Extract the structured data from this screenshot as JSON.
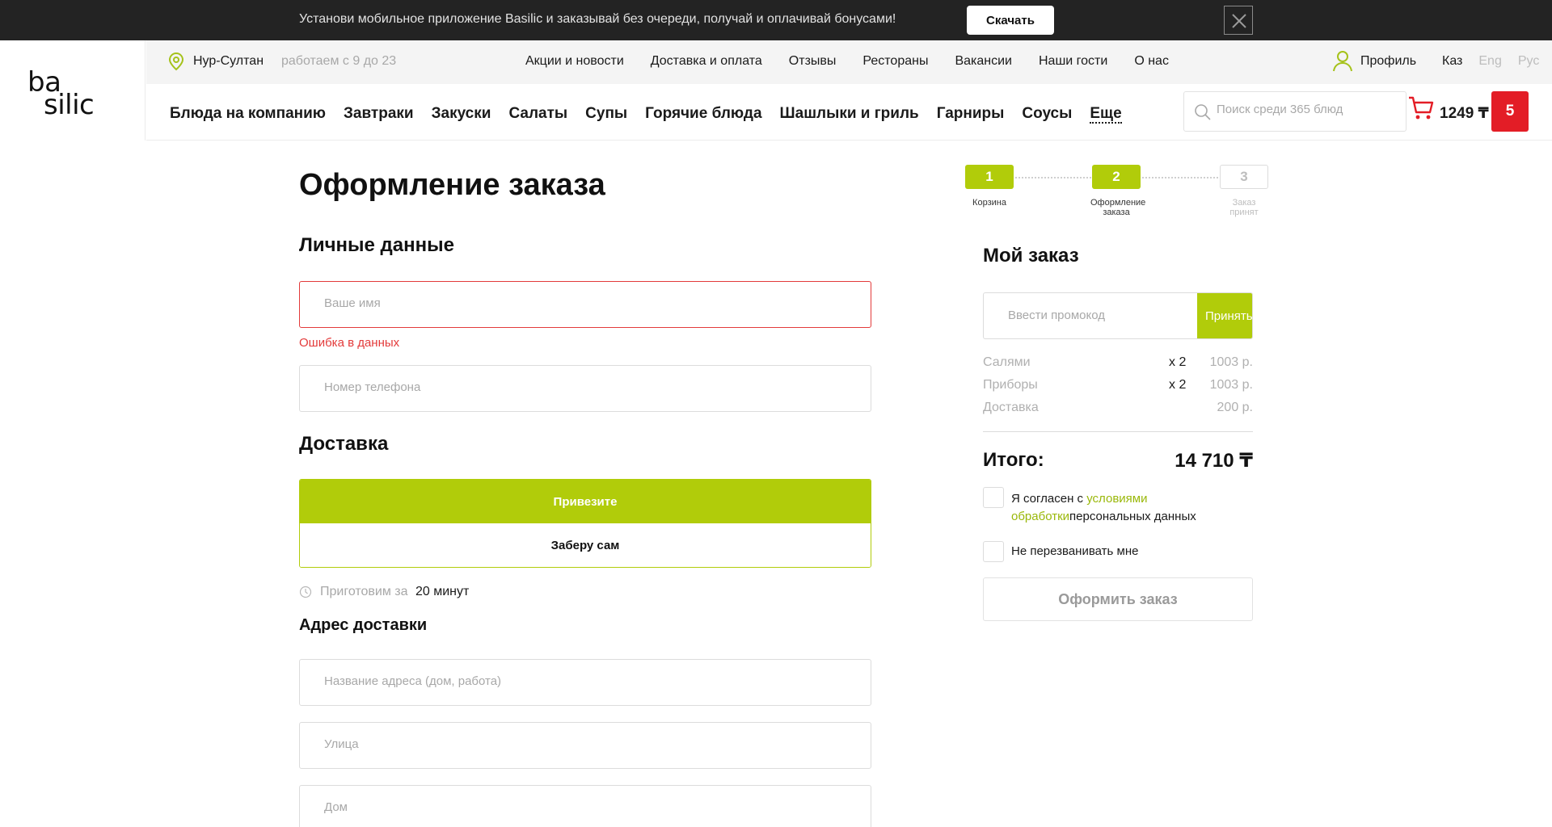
{
  "banner": {
    "text": "Установи мобильное приложение Basilic и заказывай без очереди, получай и оплачивай бонусами!",
    "download_label": "Скачать",
    "close_icon": "close-icon"
  },
  "logo": {
    "line1": "ba",
    "line2": "silic"
  },
  "topbar": {
    "city": "Нур-Султан",
    "hours": "работаем с 9 до 23",
    "links": [
      "Акции и новости",
      "Доставка и оплата",
      "Отзывы",
      "Рестораны",
      "Вакансии",
      "Наши гости",
      "О нас"
    ],
    "profile_label": "Профиль",
    "languages": [
      "Каз",
      "Eng",
      "Рус"
    ],
    "active_language": "Каз"
  },
  "mainnav": {
    "items": [
      "Блюда на компанию",
      "Завтраки",
      "Закуски",
      "Салаты",
      "Супы",
      "Горячие блюда",
      "Шашлыки и гриль",
      "Гарниры",
      "Соусы"
    ],
    "more_label": "Еще",
    "search_placeholder": "Поиск среди 365 блюд",
    "cart_total": "1249 ₸",
    "cart_count": "5"
  },
  "page": {
    "title": "Оформление заказа",
    "personal_title": "Личные данные",
    "name_placeholder": "Ваше имя",
    "name_error": "Ошибка в данных",
    "phone_placeholder": "Номер телефона",
    "delivery_title": "Доставка",
    "delivery_option": "Привезите",
    "pickup_option": "Заберу сам",
    "selected_option": "Привезите",
    "cook_label": "Приготовим за",
    "cook_time": "20 минут",
    "address_title": "Адрес доставки",
    "address_name_placeholder": "Название адреса (дом, работа)",
    "street_placeholder": "Улица",
    "house_placeholder": "Дом"
  },
  "stepper": {
    "current_step": 2,
    "steps": [
      {
        "number": "1",
        "label": "Корзина"
      },
      {
        "number": "2",
        "label": "Оформление заказа"
      },
      {
        "number": "3",
        "label": "Заказ принят"
      }
    ]
  },
  "order": {
    "title": "Мой заказ",
    "promo_placeholder": "Ввести промокод",
    "promo_button": "Принять",
    "items": [
      {
        "name": "Салями",
        "qty": "x 2",
        "price": "1003 р."
      },
      {
        "name": "Приборы",
        "qty": "x 2",
        "price": "1003 р."
      },
      {
        "name": "Доставка",
        "qty": "",
        "price": "200 р."
      }
    ],
    "total_label": "Итого:",
    "total_value": "14 710 ₸",
    "agree_prefix": "Я согласен с",
    "agree_link": "условиями обработки",
    "agree_suffix": "персональных данных",
    "no_call_label": "Не перезванивать мне",
    "submit_label": "Оформить заказ"
  },
  "colors": {
    "accent": "#b1cc0a",
    "error": "#e33a3a",
    "cart_badge": "#e31d26",
    "banner_bg": "#232323"
  }
}
